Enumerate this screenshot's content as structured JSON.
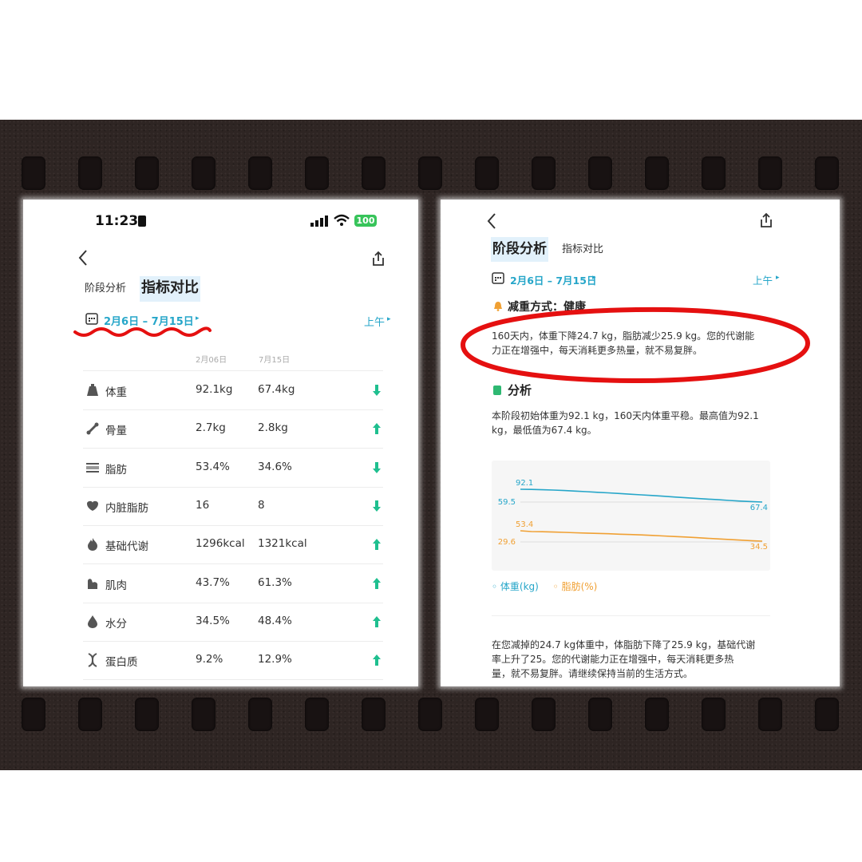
{
  "left": {
    "status_time": "11:23",
    "battery": "100",
    "tabs": {
      "stage": "阶段分析",
      "compare": "指标对比"
    },
    "date_range": "2月6日 – 7月15日",
    "period": "上午",
    "col_dates": [
      "2月06日",
      "7月15日"
    ],
    "rows": [
      {
        "label": "体重",
        "v1": "92.1kg",
        "v2": "67.4kg",
        "trend": "down",
        "icon": "weight-icon"
      },
      {
        "label": "骨量",
        "v1": "2.7kg",
        "v2": "2.8kg",
        "trend": "up",
        "icon": "bone-icon"
      },
      {
        "label": "脂肪",
        "v1": "53.4%",
        "v2": "34.6%",
        "trend": "down",
        "icon": "fat-icon"
      },
      {
        "label": "内脏脂肪",
        "v1": "16",
        "v2": "8",
        "trend": "down",
        "icon": "organ-icon"
      },
      {
        "label": "基础代谢",
        "v1": "1296kcal",
        "v2": "1321kcal",
        "trend": "up",
        "icon": "flame-icon"
      },
      {
        "label": "肌肉",
        "v1": "43.7%",
        "v2": "61.3%",
        "trend": "up",
        "icon": "muscle-icon"
      },
      {
        "label": "水分",
        "v1": "34.5%",
        "v2": "48.4%",
        "trend": "up",
        "icon": "water-drop-icon"
      },
      {
        "label": "蛋白质",
        "v1": "9.2%",
        "v2": "12.9%",
        "trend": "up",
        "icon": "dna-icon"
      }
    ]
  },
  "right": {
    "tabs": {
      "stage": "阶段分析",
      "compare": "指标对比"
    },
    "date_range": "2月6日 – 7月15日",
    "period": "上午",
    "method_label": "减重方式：健康",
    "method_text_1": "160天内，体重下降24.7 kg，脂肪减少25.9 kg。您的代谢能",
    "method_text_2": "力正在增强中，每天消耗更多热量，就不易复胖。",
    "analysis_title": "分析",
    "analysis_text_1": "本阶段初始体重为92.1 kg，160天内体重平稳。最高值为92.1",
    "analysis_text_2": "kg，最低值为67.4 kg。",
    "summary_1": "在您减掉的24.7 kg体重中，体脂肪下降了25.9 kg，基础代谢",
    "summary_2": "率上升了25。您的代谢能力正在增强中，每天消耗更多热",
    "summary_3": "量，就不易复胖。请继续保持当前的生活方式。"
  },
  "chart_data": {
    "type": "line",
    "series": [
      {
        "name": "体重(kg)",
        "color": "#26a6c9",
        "start_label": "92.1",
        "end_label": "67.4",
        "ref_label": "59.5",
        "values": [
          92.1,
          91.8,
          91.2,
          90.5,
          89.6,
          88.5,
          87.4,
          86.2,
          85.1,
          83.9,
          82.6,
          81.3,
          80.0,
          78.6,
          77.2,
          75.8,
          74.5,
          73.1,
          71.8,
          70.5,
          69.3,
          68.3,
          67.4
        ]
      },
      {
        "name": "脂肪(%)",
        "color": "#f0a033",
        "start_label": "53.4",
        "end_label": "34.5",
        "ref_label": "29.6",
        "values": [
          53.4,
          52.0,
          51.6,
          51.1,
          50.5,
          49.8,
          49.2,
          48.6,
          48.0,
          47.2,
          46.5,
          45.8,
          45.0,
          44.0,
          43.0,
          42.0,
          40.9,
          39.8,
          38.6,
          37.5,
          36.4,
          35.4,
          34.5
        ]
      }
    ],
    "legend": [
      "体重(kg)",
      "脂肪(%)"
    ],
    "legend_position": "bottom"
  },
  "colors": {
    "accent": "#26a6c9",
    "up_down": "#1fbf8f",
    "fat": "#f0a033",
    "annotation": "#e51010"
  }
}
